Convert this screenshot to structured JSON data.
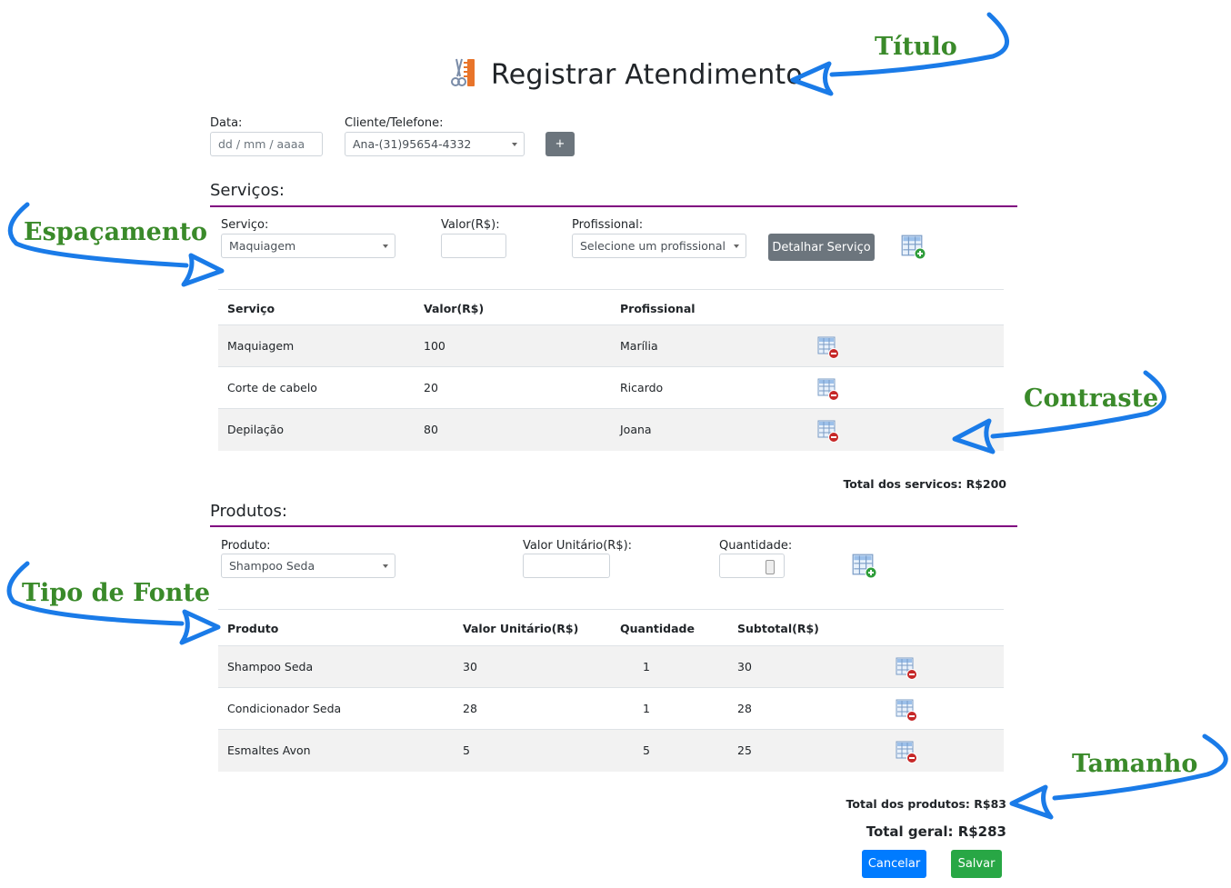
{
  "page": {
    "title": "Registrar Atendimento"
  },
  "form": {
    "data_label": "Data:",
    "data_placeholder": "dd / mm / aaaa",
    "cliente_label": "Cliente/Telefone:",
    "cliente_value": "Ana-(31)95654-4332",
    "add_client_label": "+"
  },
  "servicos": {
    "section_title": "Serviços:",
    "servico_label": "Serviço:",
    "servico_value": "Maquiagem",
    "valor_label": "Valor(R$):",
    "valor_value": "",
    "profissional_label": "Profissional:",
    "profissional_value": "Selecione um profissional",
    "detalhar_label": "Detalhar Serviço",
    "headers": [
      "Serviço",
      "Valor(R$)",
      "Profissional"
    ],
    "rows": [
      {
        "servico": "Maquiagem",
        "valor": "100",
        "profissional": "Marília"
      },
      {
        "servico": "Corte de cabelo",
        "valor": "20",
        "profissional": "Ricardo"
      },
      {
        "servico": "Depilação",
        "valor": "80",
        "profissional": "Joana"
      }
    ],
    "total": "Total dos servicos: R$200"
  },
  "produtos": {
    "section_title": "Produtos:",
    "produto_label": "Produto:",
    "produto_value": "Shampoo Seda",
    "valor_unit_label": "Valor Unitário(R$):",
    "valor_unit_value": "",
    "quantidade_label": "Quantidade:",
    "quantidade_value": "",
    "headers": [
      "Produto",
      "Valor Unitário(R$)",
      "Quantidade",
      "Subtotal(R$)"
    ],
    "rows": [
      {
        "produto": "Shampoo Seda",
        "valor": "30",
        "quantidade": "1",
        "subtotal": "30"
      },
      {
        "produto": "Condicionador Seda",
        "valor": "28",
        "quantidade": "1",
        "subtotal": "28"
      },
      {
        "produto": "Esmaltes Avon",
        "valor": "5",
        "quantidade": "5",
        "subtotal": "25"
      }
    ],
    "total": "Total dos produtos: R$83"
  },
  "total_geral": "Total geral: R$283",
  "actions": {
    "cancelar": "Cancelar",
    "salvar": "Salvar"
  },
  "annotations": {
    "titulo": "Título",
    "espacamento": "Espaçamento",
    "contraste": "Contraste",
    "tipo_fonte": "Tipo de Fonte",
    "tamanho": "Tamanho"
  },
  "colors": {
    "accent_rule": "#800080",
    "annotation_text": "#3a8a2a",
    "annotation_arrow": "#1a7be8",
    "button_gray": "#6c757d",
    "button_blue": "#007bff",
    "button_green": "#28a745"
  },
  "icons": {
    "title": "scissors-comb-icon",
    "add": "table-add-icon",
    "remove": "table-remove-icon"
  }
}
